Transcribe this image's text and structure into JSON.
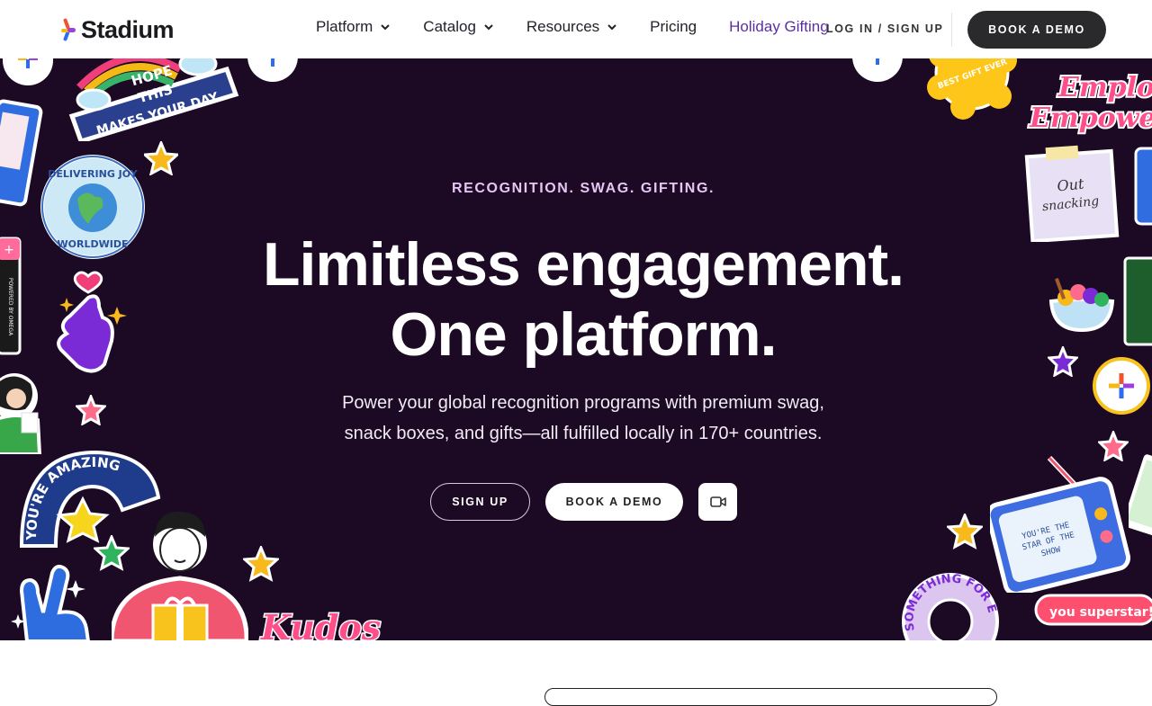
{
  "header": {
    "brand": "Stadium",
    "nav": [
      {
        "label": "Platform",
        "has_dropdown": true
      },
      {
        "label": "Catalog",
        "has_dropdown": true
      },
      {
        "label": "Resources",
        "has_dropdown": true
      },
      {
        "label": "Pricing",
        "has_dropdown": false
      },
      {
        "label": "Holiday Gifting",
        "has_dropdown": false
      }
    ],
    "login_label": "LOG IN / SIGN UP",
    "book_demo_label": "BOOK A DEMO"
  },
  "hero": {
    "eyebrow": "RECOGNITION. SWAG. GIFTING.",
    "headline_line1": "Limitless engagement.",
    "headline_line2": "One platform.",
    "sub_line1": "Power your global recognition programs with premium swag,",
    "sub_line2": "snack boxes, and gifts—all fulfilled locally in 170+ countries.",
    "signup_label": "SIGN UP",
    "book_demo_label": "BOOK A DEMO",
    "video_icon": "video-camera-icon"
  },
  "stickers": {
    "hope": {
      "line1": "HOPE",
      "line2": "THIS",
      "line3": "MAKES YOUR DAY"
    },
    "joy": {
      "top": "DELIVERING JOY",
      "bottom": "WORLDWIDE"
    },
    "amazing": "YOU'RE AMAZING",
    "kudos": "Kudos",
    "best_gift": "BEST GIFT EVER",
    "employee": {
      "line1": "Emplo",
      "line2": "Empower"
    },
    "note": {
      "line1": "Out",
      "line2": "snacking"
    },
    "tv": {
      "line1": "YOU'RE THE",
      "line2": "STAR OF THE",
      "line3": "SHOW"
    },
    "something": "SOMETHING FOR EV",
    "superstar": "you superstar!",
    "powered": "POWERED BY OMEGA"
  },
  "colors": {
    "hero_bg": "#1c0a24",
    "eyebrow": "#e6c6f2",
    "nav_highlight": "#5a2fa6",
    "dark_button": "#2a2a2d"
  }
}
